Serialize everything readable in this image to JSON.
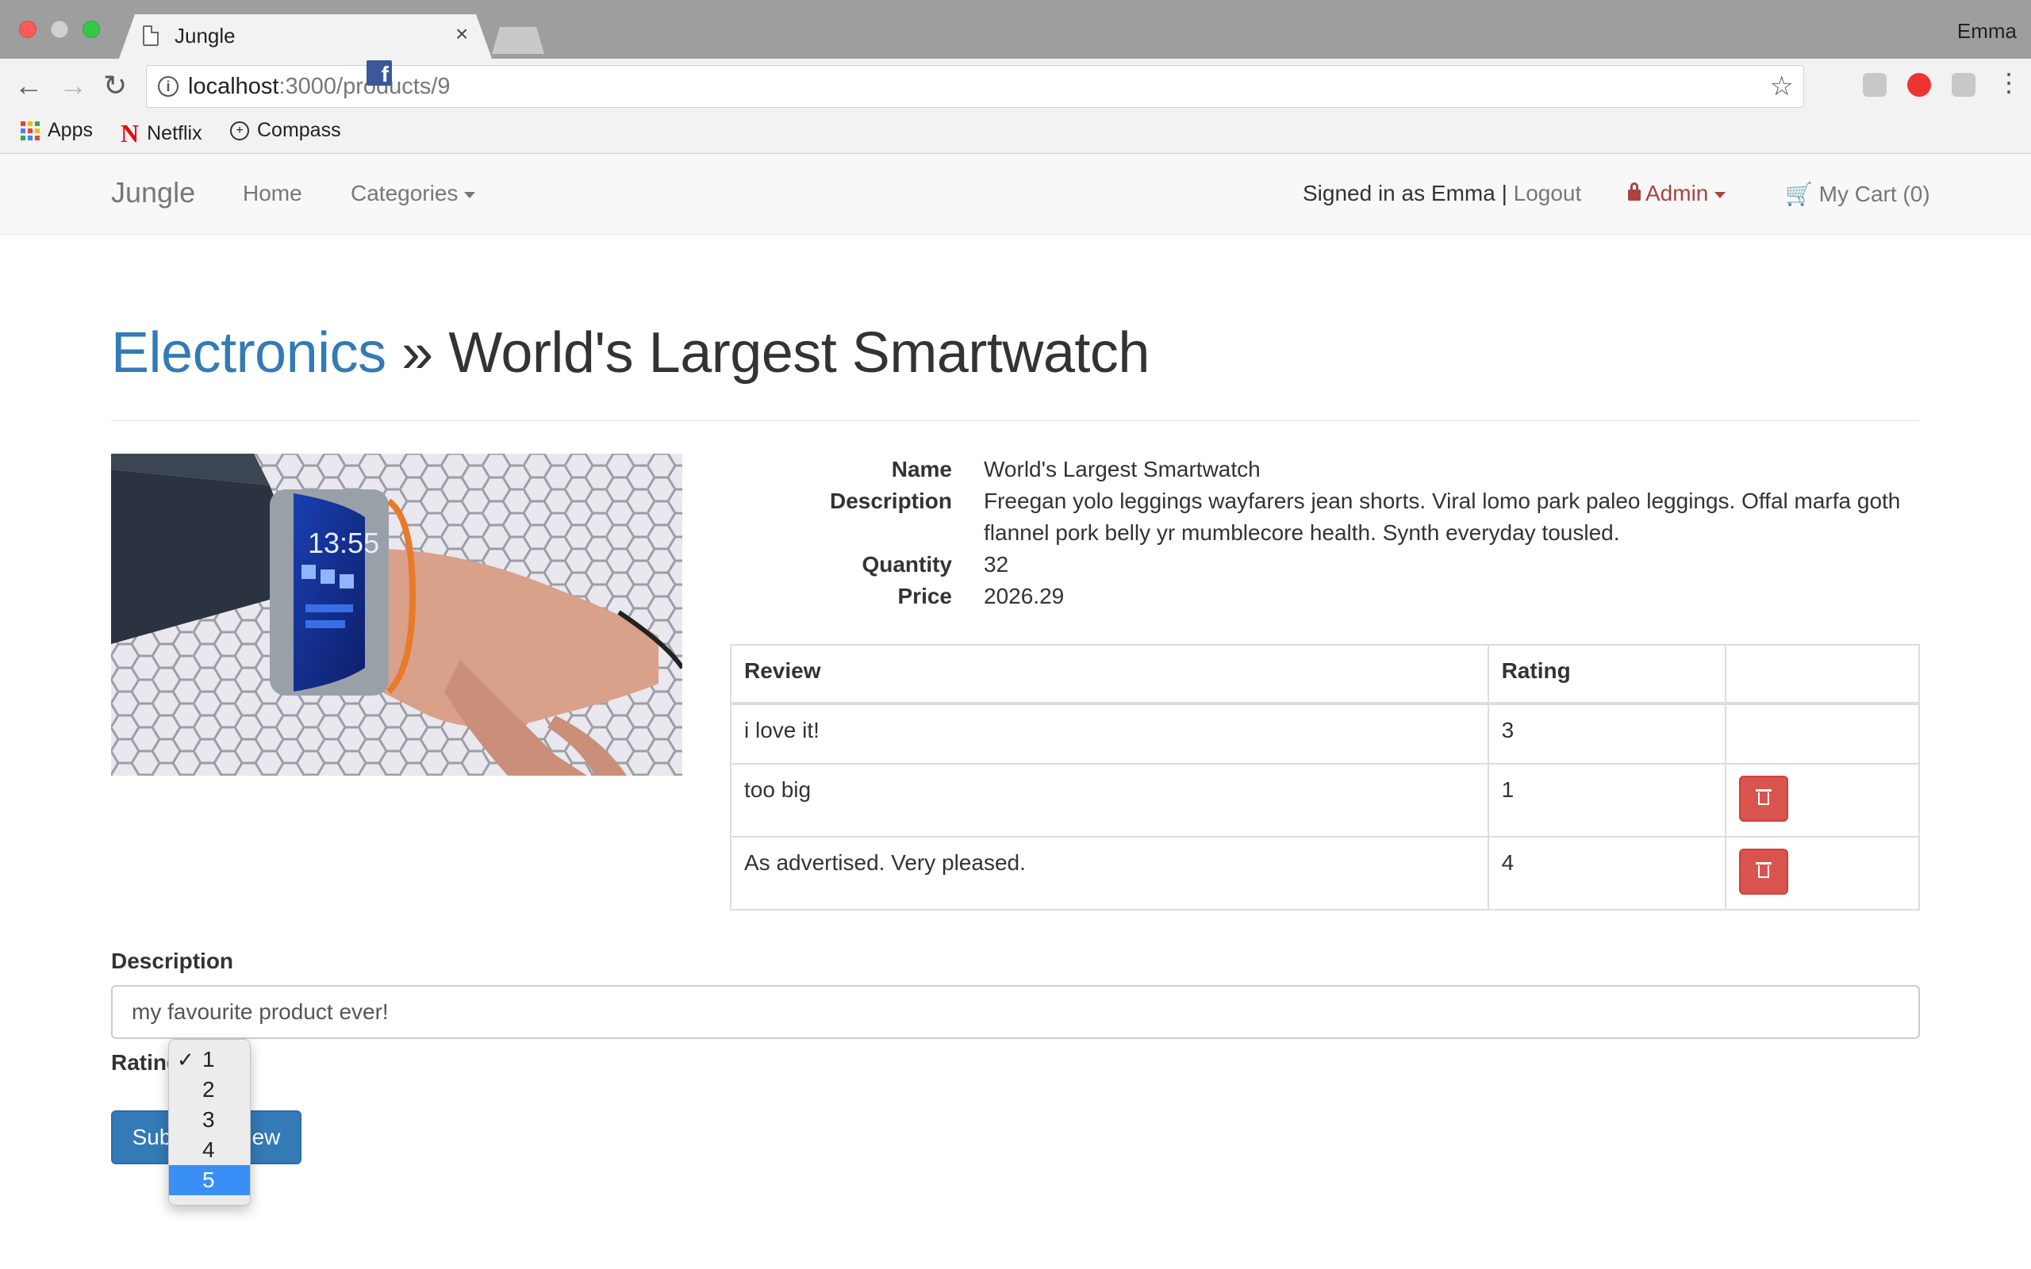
{
  "browser": {
    "tab_title": "Jungle",
    "profile_name": "Emma",
    "url_host": "localhost",
    "url_path": ":3000/products/9",
    "bookmarks": [
      {
        "label": "Apps",
        "icon": "apps-grid-icon"
      },
      {
        "label": "Netflix",
        "icon": "netflix-icon"
      },
      {
        "label": "Compass",
        "icon": "compass-icon"
      }
    ],
    "facebook_icon": "facebook-icon"
  },
  "navbar": {
    "brand": "Jungle",
    "home": "Home",
    "categories": "Categories",
    "signed_in": "Signed in as Emma |",
    "logout": "Logout",
    "admin": "Admin",
    "cart": "My Cart (0)"
  },
  "product": {
    "category": "Electronics",
    "separator": " » ",
    "title": "World's Largest Smartwatch",
    "fields": [
      {
        "label": "Name",
        "value": "World's Largest Smartwatch"
      },
      {
        "label": "Description",
        "value": "Freegan yolo leggings wayfarers jean shorts. Viral lomo park paleo leggings. Offal marfa goth flannel pork belly yr mumblecore health. Synth everyday tousled."
      },
      {
        "label": "Quantity",
        "value": "32"
      },
      {
        "label": "Price",
        "value": "2026.29"
      }
    ],
    "image_time": "13:55"
  },
  "reviews": {
    "headers": [
      "Review",
      "Rating",
      ""
    ],
    "rows": [
      {
        "review": "i love it!",
        "rating": "3",
        "deletable": false
      },
      {
        "review": "too big",
        "rating": "1",
        "deletable": true
      },
      {
        "review": "As advertised. Very pleased.",
        "rating": "4",
        "deletable": true
      }
    ]
  },
  "form": {
    "description_label": "Description",
    "description_value": "my favourite product ever!",
    "rating_label": "Rating",
    "submit_label": "Submit Review",
    "rating_options": [
      "1",
      "2",
      "3",
      "4",
      "5"
    ],
    "rating_selected": "1",
    "rating_highlighted": "5"
  },
  "colors": {
    "link_blue": "#337ab7",
    "danger_red": "#d9534f",
    "admin_red": "#a94442",
    "highlight_blue": "#3a8ff7"
  }
}
